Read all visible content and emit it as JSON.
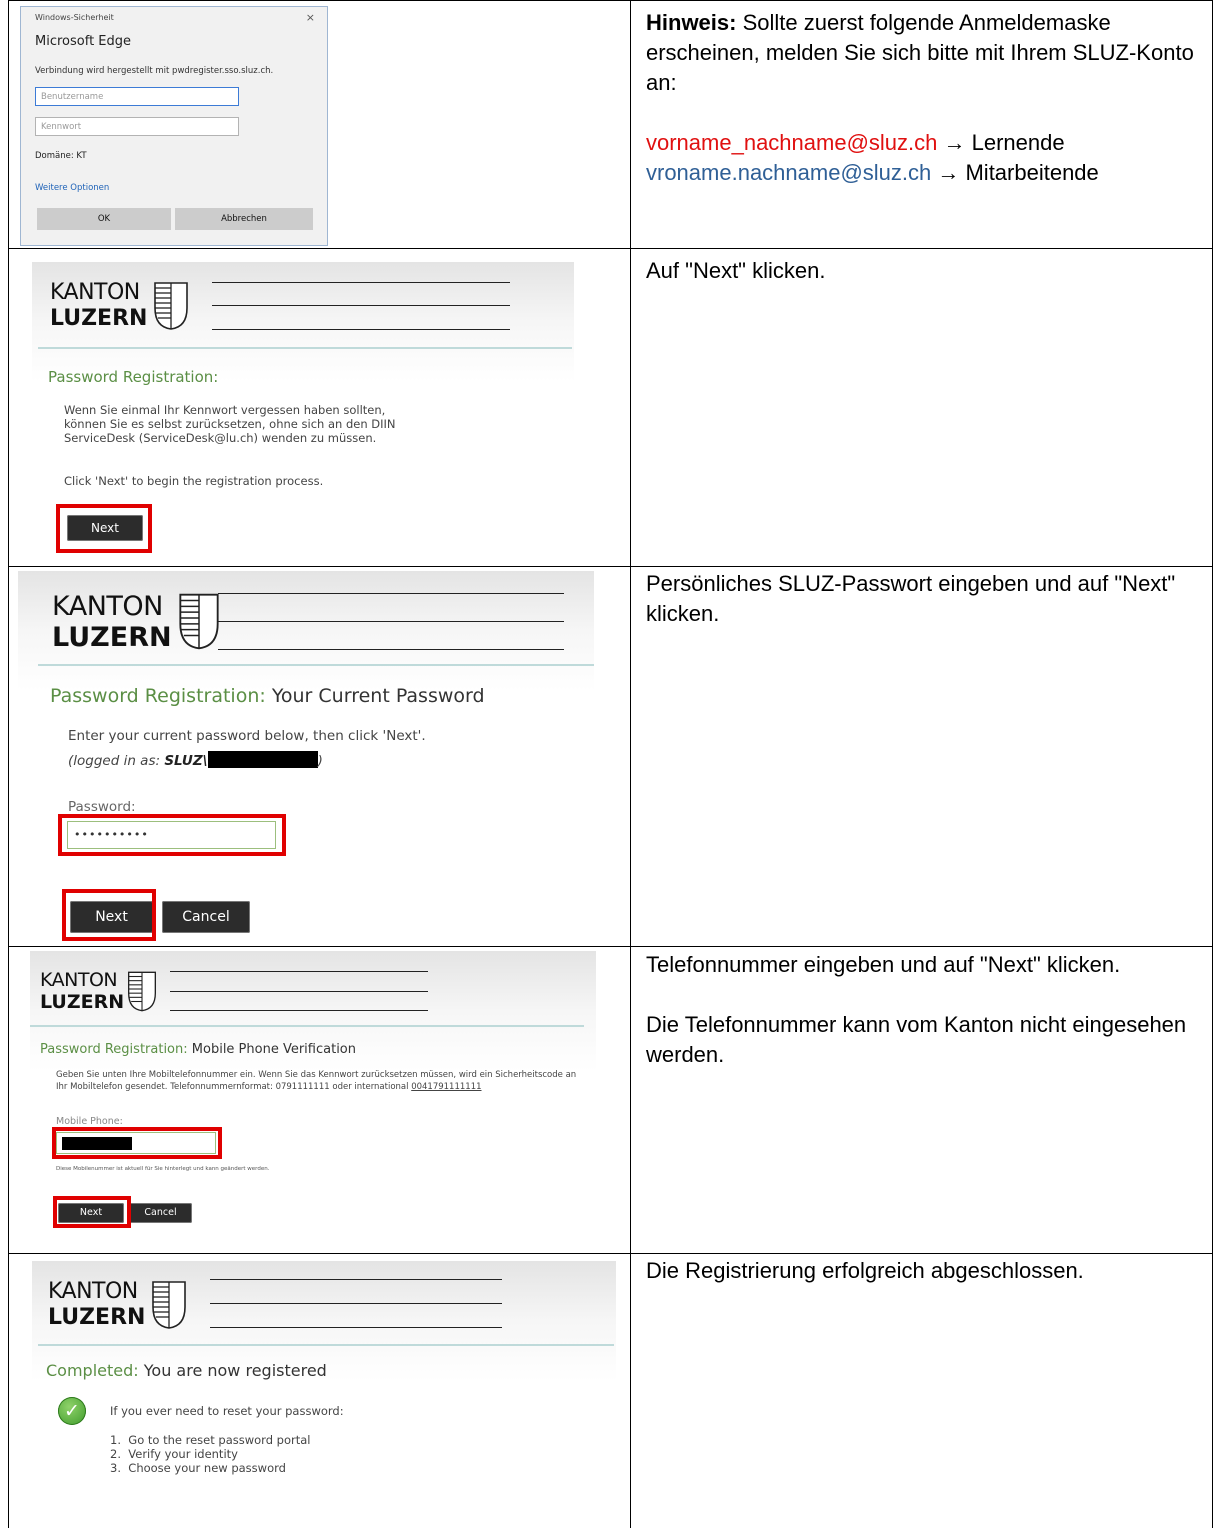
{
  "row1": {
    "dialog": {
      "caption": "Windows-Sicherheit",
      "close_glyph": "×",
      "title": "Microsoft Edge",
      "message": "Verbindung wird hergestellt mit pwdregister.sso.sluz.ch.",
      "username_placeholder": "Benutzername",
      "password_placeholder": "Kennwort",
      "domain": "Domäne: KT",
      "more_options": "Weitere Optionen",
      "ok": "OK",
      "cancel": "Abbrechen"
    },
    "desc": {
      "hint_bold": "Hinweis:",
      "hint_rest": " Sollte zuerst folgende Anmeldemaske erscheinen, melden Sie sich bitte mit Ihrem SLUZ-Konto an:",
      "learner_email": "vorname_nachname@sluz.ch",
      "learner_role": " → Lernende",
      "staff_email": "vroname.nachname@sluz.ch",
      "staff_role": " → Mitarbeitende"
    }
  },
  "logo": {
    "line1": "KANTON",
    "line2": "LUZERN"
  },
  "row2": {
    "title": "Password Registration:",
    "p1": "Wenn Sie einmal Ihr Kennwort vergessen haben sollten, können Sie es selbst zurücksetzen, ohne sich an den DIIN ServiceDesk (ServiceDesk@lu.ch) wenden zu müssen.",
    "p2": "Click 'Next' to begin the registration process.",
    "next": "Next",
    "desc": "Auf \"Next\" klicken."
  },
  "row3": {
    "title_green": "Password Registration:",
    "title_dark": "Your Current Password",
    "p1": "Enter your current password below, then click 'Next'.",
    "logged_prefix": "(logged in as: ",
    "logged_user": "SLUZ\\",
    "logged_suffix": ")",
    "label": "Password:",
    "password_value": "••••••••••",
    "next": "Next",
    "cancel": "Cancel",
    "desc": "Persönliches SLUZ-Passwort eingeben und auf \"Next\" klicken."
  },
  "row4": {
    "title_green": "Password Registration:",
    "title_dark": "Mobile Phone Verification",
    "p1_a": "Geben Sie unten Ihre Mobiltelefonnummer ein. Wenn Sie das Kennwort zurücksetzen müssen, wird ein Sicherheitscode an Ihr Mobiltelefon gesendet. Telefonnummernformat: 0791111111 oder international ",
    "p1_b": "0041791111111",
    "label": "Mobile Phone:",
    "note": "Diese Mobilenummer ist aktuell für Sie hinterlegt und kann geändert werden.",
    "next": "Next",
    "cancel": "Cancel",
    "desc1": "Telefonnummer eingeben und auf \"Next\" klicken.",
    "desc2": "Die Telefonnummer kann vom Kanton nicht eingesehen werden."
  },
  "row5": {
    "title_green": "Completed:",
    "title_dark": "You are now registered",
    "intro": "If you ever need to reset your password:",
    "steps": [
      "1.  Go to the reset password portal",
      "2.  Verify your identity",
      "3.  Choose your new password"
    ],
    "check_glyph": "✓",
    "desc": "Die Registrierung erfolgreich abgeschlossen."
  },
  "colors": {
    "accent_green": "#5b8f45",
    "highlight_red": "#e00000",
    "email_red": "#e01010",
    "email_blue": "#2f5f96"
  }
}
